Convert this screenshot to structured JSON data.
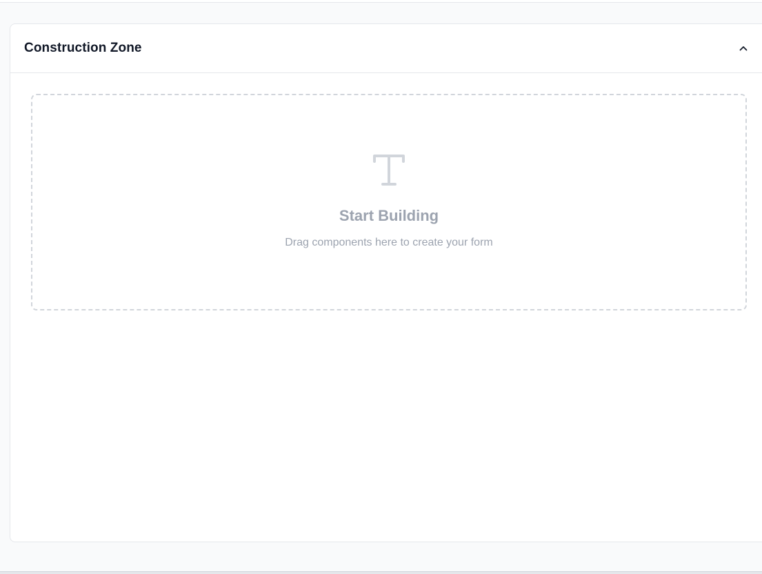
{
  "panel": {
    "title": "Construction Zone",
    "toggle_icon": "chevron-up-icon"
  },
  "dropzone": {
    "icon": "text-type-icon",
    "title": "Start Building",
    "subtitle": "Drag components here to create your form"
  },
  "colors": {
    "page_background": "#f9fafb",
    "panel_background": "#ffffff",
    "border": "#e5e7eb",
    "dashed_border": "#d1d5db",
    "title_text": "#111827",
    "muted_text": "#9ca3af",
    "icon": "#d1d5db"
  }
}
